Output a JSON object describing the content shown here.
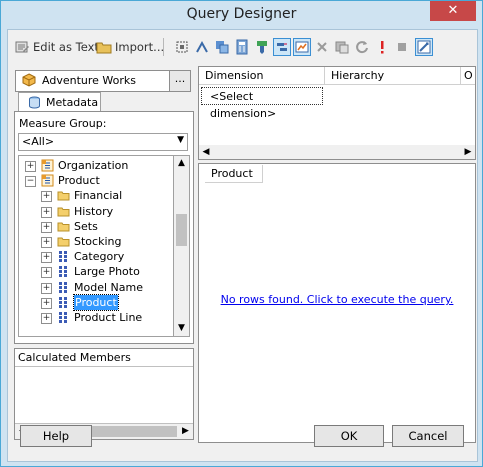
{
  "window": {
    "title": "Query Designer",
    "close_symbol": "✕"
  },
  "toolbar": {
    "edit_as_text_label": "Edit as Text",
    "import_label": "Import..."
  },
  "cube": {
    "name": "Adventure Works",
    "browse_label": "..."
  },
  "metadata_tab": {
    "label": "Metadata"
  },
  "measure_group": {
    "label": "Measure Group:",
    "selected": "<All>"
  },
  "tree": {
    "items": [
      {
        "label": "Organization",
        "expander": "+",
        "icon": "hierarchy-icon"
      },
      {
        "label": "Product",
        "expander": "−",
        "icon": "hierarchy-icon"
      },
      {
        "label": "Financial",
        "expander": "+",
        "icon": "folder-icon"
      },
      {
        "label": "History",
        "expander": "+",
        "icon": "folder-icon"
      },
      {
        "label": "Sets",
        "expander": "+",
        "icon": "folder-icon"
      },
      {
        "label": "Stocking",
        "expander": "+",
        "icon": "folder-icon"
      },
      {
        "label": "Category",
        "expander": "+",
        "icon": "attribute-icon"
      },
      {
        "label": "Large Photo",
        "expander": "+",
        "icon": "attribute-icon"
      },
      {
        "label": "Model Name",
        "expander": "+",
        "icon": "attribute-icon"
      },
      {
        "label": "Product",
        "expander": "+",
        "icon": "attribute-icon",
        "selected": true
      },
      {
        "label": "Product Line",
        "expander": "+",
        "icon": "attribute-icon"
      }
    ]
  },
  "calculated_members": {
    "label": "Calculated Members"
  },
  "filter_grid": {
    "columns": [
      "Dimension",
      "Hierarchy",
      "O"
    ],
    "select_dimension": "<Select dimension>"
  },
  "results": {
    "column_header": "Product",
    "empty_message": "No rows found. Click to execute the query."
  },
  "buttons": {
    "help": "Help",
    "ok": "OK",
    "cancel": "Cancel"
  },
  "colors": {
    "accent": "#3399ff",
    "frame": "#cfe3f1",
    "close": "#c74848",
    "link": "#0000ee"
  }
}
